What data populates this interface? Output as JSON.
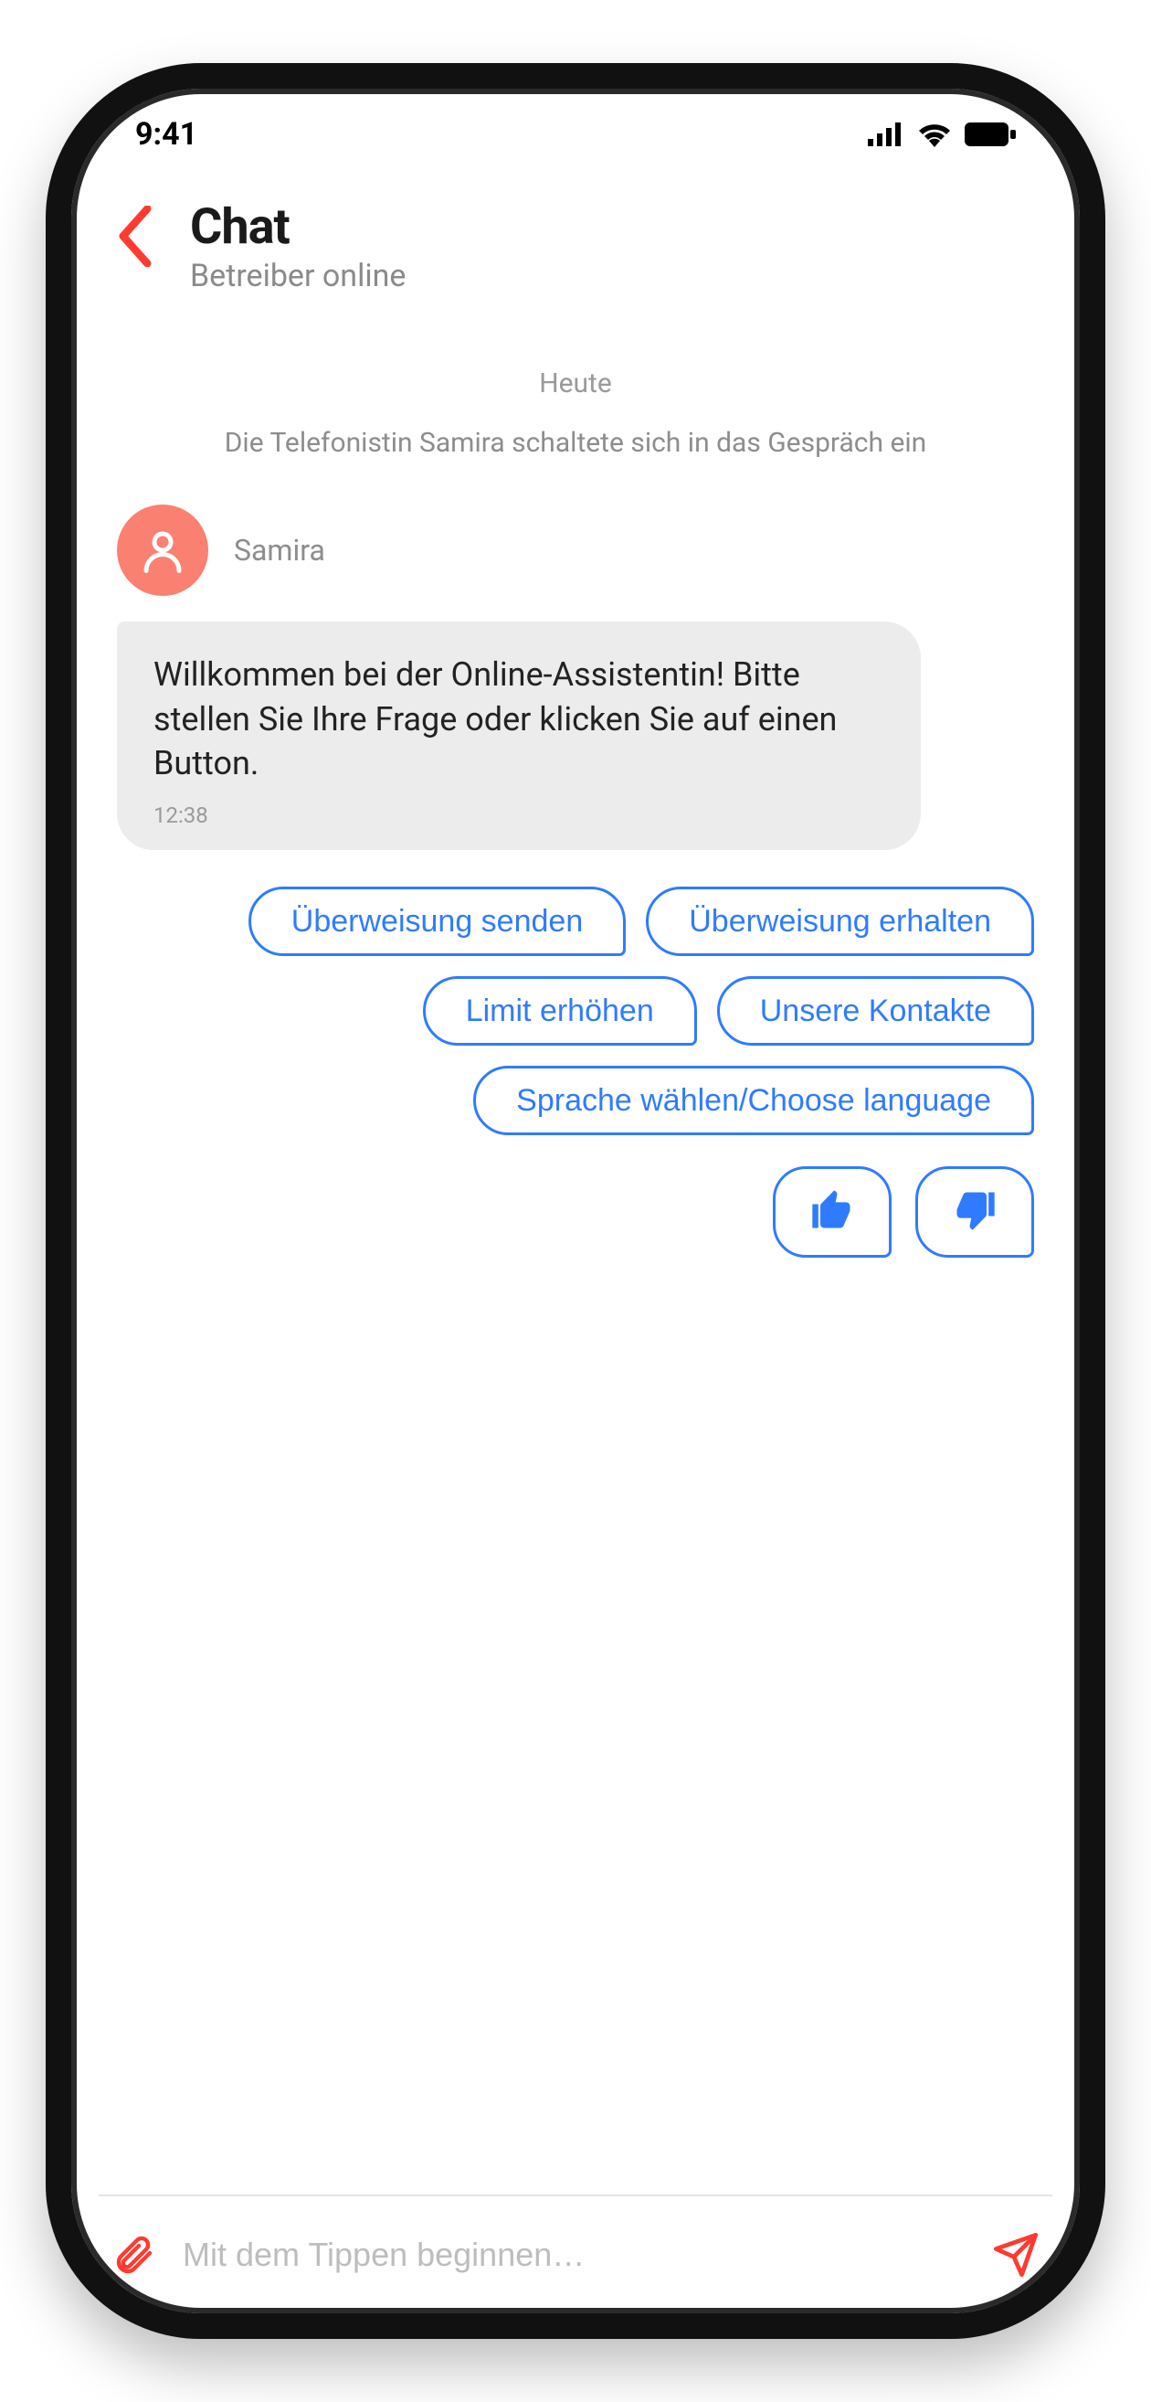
{
  "status": {
    "time": "9:41"
  },
  "header": {
    "title": "Chat",
    "subtitle": "Betreiber online"
  },
  "chat": {
    "date_separator": "Heute",
    "system_message": "Die Telefonistin Samira schaltete sich in das Gespräch ein",
    "sender_name": "Samira",
    "message_text": "Willkommen bei der Online-Assistentin! Bitte stellen Sie Ihre Frage oder klicken Sie auf einen Button.",
    "message_time": "12:38",
    "quick_replies": [
      "Überweisung senden",
      "Überweisung erhalten",
      "Limit erhöhen",
      "Unsere Kontakte",
      "Sprache wählen/Choose language"
    ]
  },
  "input": {
    "placeholder": "Mit dem Tippen beginnen…"
  }
}
